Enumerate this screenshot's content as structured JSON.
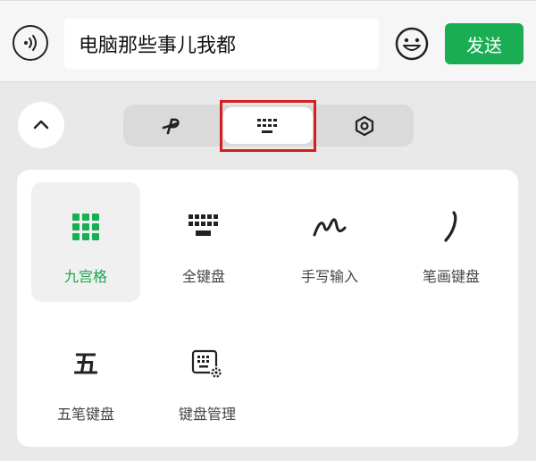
{
  "input": {
    "text": "电脑那些事儿我都"
  },
  "send_label": "发送",
  "colors": {
    "accent": "#1aad53",
    "highlight": "#d71e1e",
    "icon": "#222222"
  },
  "mode_tabs": [
    {
      "icon": "handwriting-p-icon"
    },
    {
      "icon": "keyboard-icon",
      "selected": true
    },
    {
      "icon": "settings-hexagon-icon"
    }
  ],
  "keyboards": [
    {
      "label": "九宫格",
      "icon": "nine-grid-icon",
      "active": true
    },
    {
      "label": "全键盘",
      "icon": "full-keyboard-icon"
    },
    {
      "label": "手写输入",
      "icon": "handwriting-squiggle-icon"
    },
    {
      "label": "笔画键盘",
      "icon": "stroke-icon"
    },
    {
      "label": "五笔键盘",
      "icon": "wubi-icon",
      "glyph": "五"
    },
    {
      "label": "键盘管理",
      "icon": "keyboard-settings-icon"
    }
  ]
}
